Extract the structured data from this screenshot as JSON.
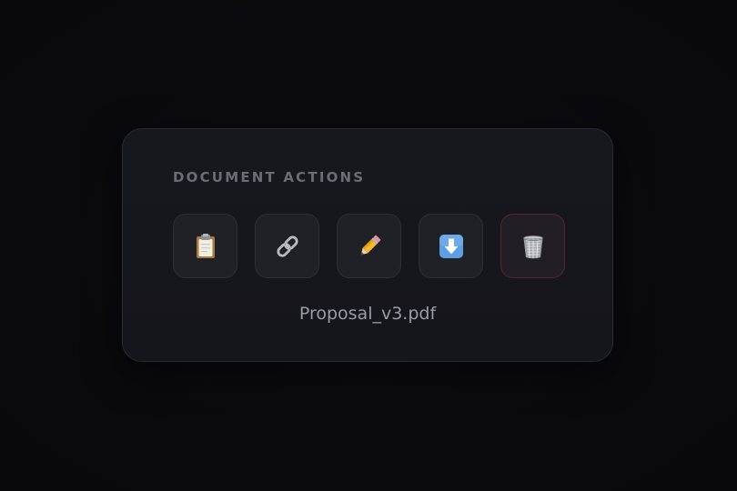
{
  "panel": {
    "title": "DOCUMENT ACTIONS",
    "filename": "Proposal_v3.pdf"
  },
  "actions": [
    {
      "icon": "clipboard-icon"
    },
    {
      "icon": "link-icon"
    },
    {
      "icon": "pencil-icon"
    },
    {
      "icon": "download-icon"
    },
    {
      "icon": "trash-icon",
      "style": "danger",
      "border_color": "#5a2529"
    }
  ],
  "colors": {
    "background": "#0a0a0e",
    "card": "#17181e",
    "button": "#202127",
    "title_text": "#6b6d76",
    "filename_text": "#9a9ca6",
    "danger_border": "#5a2529"
  }
}
